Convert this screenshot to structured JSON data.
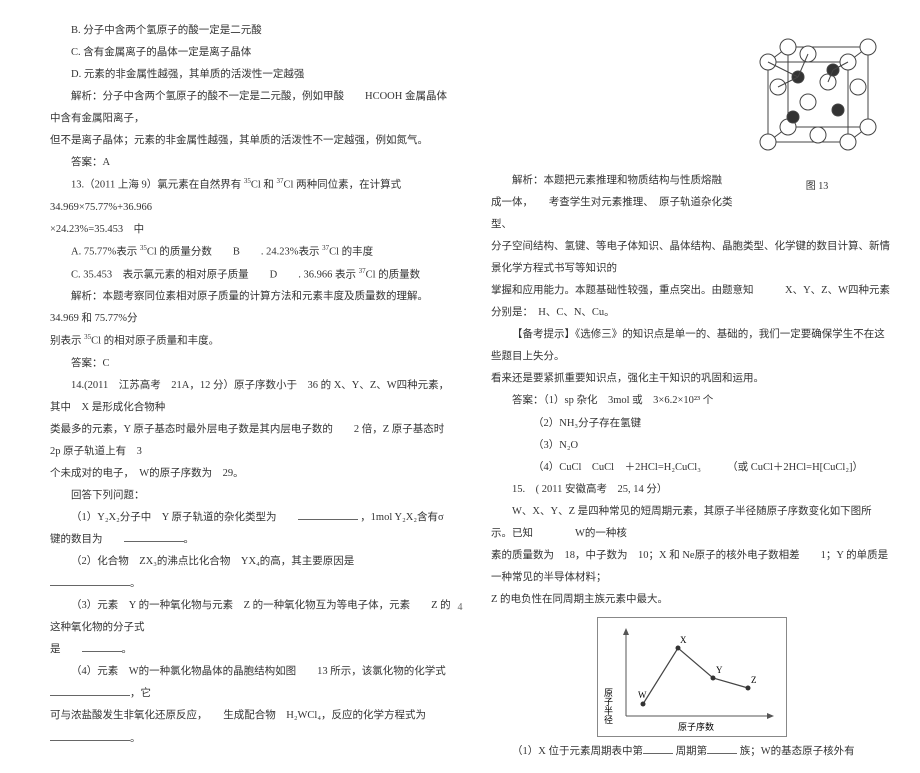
{
  "left": {
    "optB": "B. 分子中含两个氢原子的酸一定是二元酸",
    "optC": "C. 含有金属离子的晶体一定是离子晶体",
    "optD": "D. 元素的非金属性越强，其单质的活泼性一定越强",
    "analysis1": "解析：分子中含两个氢原子的酸不一定是二元酸，例如甲酸　　HCOOH 金属晶体中含有金属阳离子，",
    "analysis2": "但不是离子晶体；元素的非金属性越强，其单质的活泼性不一定越强，例如氮气。",
    "ans12": "答案：A",
    "q13a": "13.（2011 上海 9）氯元素在自然界有",
    "q13b": "Cl 和",
    "q13c": "Cl 两种同位素，在计算式　　34.969×75.77%+36.966",
    "q13d": "×24.23%=35.453　中",
    "q13optA": "A. 75.77%表示",
    "q13optA2": "Cl 的质量分数　　B　　. 24.23%表示",
    "q13optA3": "Cl 的丰度",
    "q13optC": "C. 35.453　表示氯元素的相对原子质量　　D　　. 36.966 表示",
    "q13optC2": "Cl 的质量数",
    "q13ana1": "解析：本题考察同位素相对原子质量的计算方法和元素丰度及质量数的理解。　　　　34.969 和 75.77%分",
    "q13ana2": "别表示",
    "q13ana3": "Cl 的相对原子质量和丰度。",
    "ans13": "答案：C",
    "q14a": "14.(2011　江苏高考　21A，12 分）原子序数小于　36 的 X、Y、Z、W四种元素，其中　X 是形成化合物种",
    "q14b": "类最多的元素，Y 原子基态时最外层电子数是其内层电子数的　　2 倍，Z 原子基态时 2p 原子轨道上有　3",
    "q14c": "个未成对的电子，　W的原子序数为　29。",
    "q14d": "回答下列问题：",
    "q14_1a": "（1）Y₂X₂分子中　Y 原子轨道的杂化类型为　　",
    "q14_1b": "，1mol Y₂X₂含有σ键的数目为　　",
    "q14_1c": "。",
    "q14_2a": "（2）化合物　ZX₃的沸点比化合物　YX₄的高，其主要原因是　　",
    "q14_2b": "。",
    "q14_3a": "（3）元素　Y 的一种氧化物与元素　Z 的一种氧化物互为等电子体，元素　　Z 的这种氧化物的分子式",
    "q14_3b": "是　　",
    "q14_3c": "。",
    "q14_4a": "（4）元素　W的一种氯化物晶体的晶胞结构如图　　13 所示，该氯化物的化学式　　",
    "q14_4b": "，它",
    "q14_4c": "可与浓盐酸发生非氧化还原反应，　　生成配合物　H₂WCl₄，反应的化学方程式为　　",
    "q14_4d": "。"
  },
  "right": {
    "fig13": "图 13",
    "ana1": "解析：本题把元素推理和物质结构与性质熔融成一体，　　考查学生对元素推理、　原子轨道杂化类型、",
    "ana2": "分子空间结构、氢键、等电子体知识、晶体结构、晶胞类型、化学键的数目计算、新情景化学方程式书写等知识的",
    "ana3": "掌握和应用能力。本题基础性较强，重点突出。由题意知　　　X、Y、Z、W四种元素分别是：　H、C、N、Cu。",
    "tip": "【备考提示】《选修三》的知识点是单一的、基础的，我们一定要确保学生不在这些题目上失分。",
    "tip2": "看来还是要紧抓重要知识点，强化主干知识的巩固和运用。",
    "ansHead": "答案：（1）sp 杂化　3mol 或　3×6.2×10²³ 个",
    "ans2": "（2）NH₃分子存在氢键",
    "ans3": "（3）N₂O",
    "ans4": "（4）CuCl　CuCl　＋2HCl=H₂CuCl₃　　　（或 CuCl＋2HCl=H[CuCl₂]）",
    "q15a": "15.　( 2011 安徽高考　25, 14 分）",
    "q15b": "W、X、Y、Z 是四种常见的短周期元素，其原子半径随原子序数变化如下图所示。已知　　　　W的一种核",
    "q15c": "素的质量数为　18，中子数为　10；X 和 Ne原子的核外电子数相差　　1；Y 的单质是一种常见的半导体材料；",
    "q15d": "Z 的电负性在同周期主族元素中最大。",
    "q15_1a": "（1）X 位于元素周期表中第",
    "q15_1b": "周期第",
    "q15_1c": "族；W的基态原子核外有",
    "chart_xlabel": "原子序数",
    "chart_ylabel": "原子半径",
    "chart_pts": [
      "W",
      "X",
      "Y",
      "Z"
    ]
  },
  "pagenum": "4",
  "iso35": "35",
  "iso37": "37"
}
